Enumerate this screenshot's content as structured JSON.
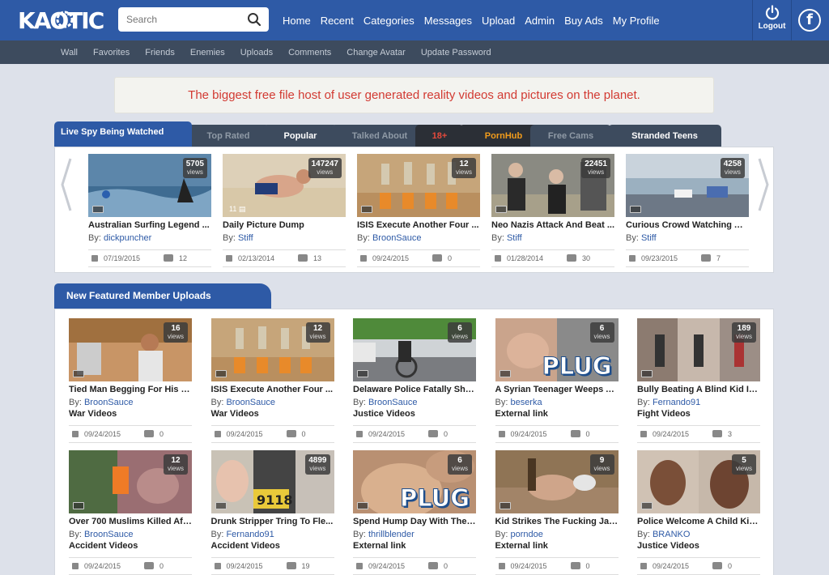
{
  "brand": {
    "logo": "KAOTIC"
  },
  "search": {
    "placeholder": "Search"
  },
  "nav": [
    "Home",
    "Recent",
    "Categories",
    "Messages",
    "Upload",
    "Admin",
    "Buy Ads",
    "My Profile"
  ],
  "logout_label": "Logout",
  "subnav": [
    "Wall",
    "Favorites",
    "Friends",
    "Enemies",
    "Uploads",
    "Comments",
    "Change Avatar",
    "Update Password"
  ],
  "banner": "The biggest free file host of user generated reality videos and pictures on the planet.",
  "tabs": [
    "Live Spy Being Watched",
    "Top Rated",
    "Popular",
    "Talked About",
    "18+",
    "PornHub",
    "Free Cams",
    "Stranded Teens"
  ],
  "by_label": "By:",
  "views_label": "views",
  "plug_label": "PLUG",
  "spy": [
    {
      "title": "Australian Surfing Legend ...",
      "author": "dickpuncher",
      "views": "5705",
      "date": "07/19/2015",
      "comments": "12",
      "scene": "sea"
    },
    {
      "title": "Daily Picture Dump",
      "author": "Stiff",
      "views": "147247",
      "date": "02/13/2014",
      "comments": "13",
      "count": "11",
      "scene": "beach"
    },
    {
      "title": "ISIS Execute Another Four ...",
      "author": "BroonSauce",
      "views": "12",
      "date": "09/24/2015",
      "comments": "0",
      "scene": "desert"
    },
    {
      "title": "Neo Nazis Attack And Beat ...",
      "author": "Stiff",
      "views": "22451",
      "date": "01/28/2014",
      "comments": "30",
      "scene": "street"
    },
    {
      "title": "Curious Crowd Watching A ...",
      "author": "Stiff",
      "views": "4258",
      "date": "09/23/2015",
      "comments": "7",
      "scene": "shore"
    }
  ],
  "featured_heading": "New Featured Member Uploads",
  "featured": [
    {
      "title": "Tied Man Begging For His L...",
      "author": "BroonSauce",
      "category": "War Videos",
      "views": "16",
      "date": "09/24/2015",
      "comments": "0",
      "scene": "sand"
    },
    {
      "title": "ISIS Execute Another Four ...",
      "author": "BroonSauce",
      "category": "War Videos",
      "views": "12",
      "date": "09/24/2015",
      "comments": "0",
      "scene": "desert"
    },
    {
      "title": "Delaware Police Fatally Sho...",
      "author": "BroonSauce",
      "category": "Justice Videos",
      "views": "6",
      "date": "09/24/2015",
      "comments": "0",
      "scene": "road"
    },
    {
      "title": "A Syrian Teenager Weeps A...",
      "author": "beserka",
      "category": "External link",
      "views": "6",
      "date": "09/24/2015",
      "comments": "0",
      "scene": "skin",
      "plug": true
    },
    {
      "title": "Bully Beating A Blind Kid Is...",
      "author": "Fernando91",
      "category": "Fight Videos",
      "views": "189",
      "date": "09/24/2015",
      "comments": "3",
      "scene": "collage"
    },
    {
      "title": "Over 700 Muslims Killed Aft...",
      "author": "BroonSauce",
      "category": "Accident Videos",
      "views": "12",
      "date": "09/24/2015",
      "comments": "0",
      "scene": "crowd"
    },
    {
      "title": "Drunk Stripper Tring To Fle...",
      "author": "Fernando91",
      "category": "Accident Videos",
      "views": "4899",
      "date": "09/24/2015",
      "comments": "19",
      "scene": "plate"
    },
    {
      "title": "Spend Hump Day With The ...",
      "author": "thrillblender",
      "category": "External link",
      "views": "6",
      "date": "09/24/2015",
      "comments": "0",
      "scene": "skin2",
      "plug": true
    },
    {
      "title": "Kid Strikes The Fucking Jac...",
      "author": "porndoe",
      "category": "External link",
      "views": "9",
      "date": "09/24/2015",
      "comments": "0",
      "scene": "room"
    },
    {
      "title": "Police Welcome A Child Kill...",
      "author": "BRANKO",
      "category": "Justice Videos",
      "views": "5",
      "date": "09/24/2015",
      "comments": "0",
      "scene": "faces"
    }
  ],
  "colors": {
    "brand_blue": "#2e5aa6",
    "subbar": "#3d4b5e",
    "banner_text": "#d23a32",
    "page_bg": "#dde1ea"
  }
}
